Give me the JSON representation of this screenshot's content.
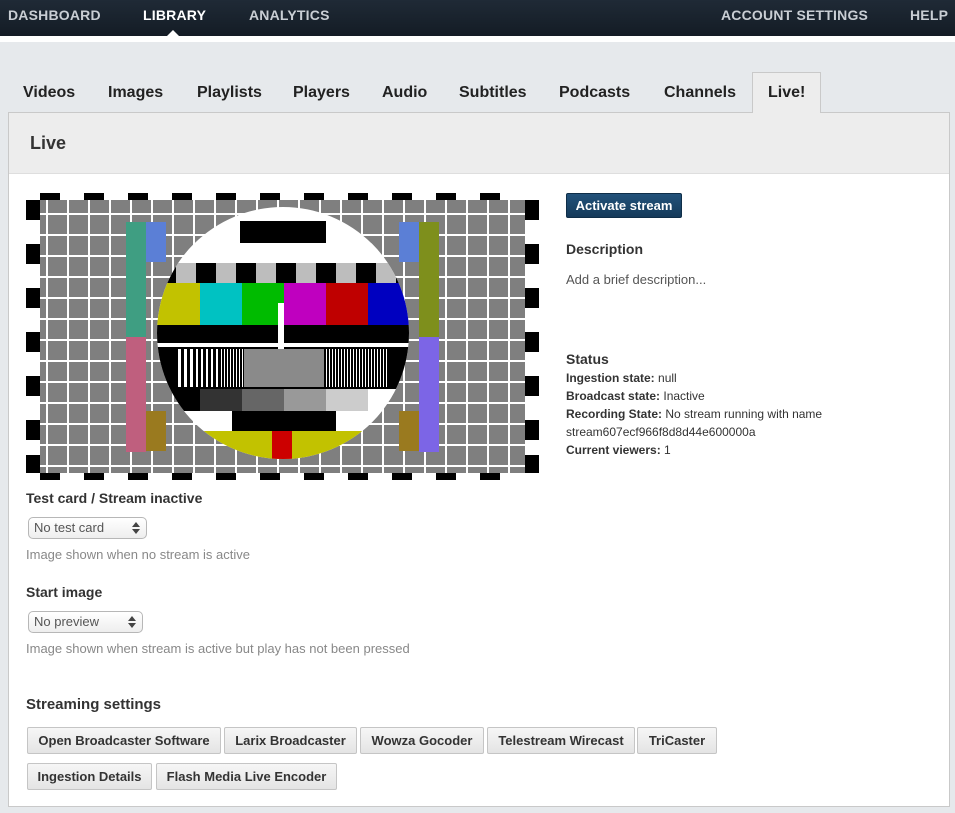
{
  "topnav": {
    "dashboard": "DASHBOARD",
    "library": "LIBRARY",
    "analytics": "ANALYTICS",
    "account_settings": "ACCOUNT SETTINGS",
    "help": "HELP"
  },
  "tabs": [
    {
      "label": "Videos"
    },
    {
      "label": "Images"
    },
    {
      "label": "Playlists"
    },
    {
      "label": "Players"
    },
    {
      "label": "Audio"
    },
    {
      "label": "Subtitles"
    },
    {
      "label": "Podcasts"
    },
    {
      "label": "Channels"
    },
    {
      "label": "Live!"
    }
  ],
  "panel": {
    "title": "Live"
  },
  "testcard_section": {
    "label": "Test card / Stream inactive",
    "select_value": "No test card",
    "hint": "Image shown when no stream is active"
  },
  "start_image_section": {
    "label": "Start image",
    "select_value": "No preview",
    "hint": "Image shown when stream is active but play has not been pressed"
  },
  "streaming": {
    "label": "Streaming settings",
    "buttons": [
      "Open Broadcaster Software",
      "Larix Broadcaster",
      "Wowza Gocoder",
      "Telestream Wirecast",
      "TriCaster",
      "Ingestion Details",
      "Flash Media Live Encoder"
    ]
  },
  "right": {
    "activate_button": "Activate stream",
    "description_label": "Description",
    "description_placeholder": "Add a brief description...",
    "status_label": "Status",
    "ingestion_state_key": "Ingestion state:",
    "ingestion_state_value": "null",
    "broadcast_state_key": "Broadcast state:",
    "broadcast_state_value": "Inactive",
    "recording_state_key": "Recording State:",
    "recording_state_value": "No stream running with name",
    "recording_state_value_cont": "stream607ecf966f8d8d44e600000a",
    "current_viewers_key": "Current viewers:",
    "current_viewers_value": "1"
  },
  "colors": {
    "nav_bg": "#18212c",
    "primary_button": "#1b4467",
    "panel_header": "#ededed"
  },
  "icons": {
    "library_active_caret": "caret-up-icon",
    "select_arrows": "updown-arrows-icon"
  }
}
